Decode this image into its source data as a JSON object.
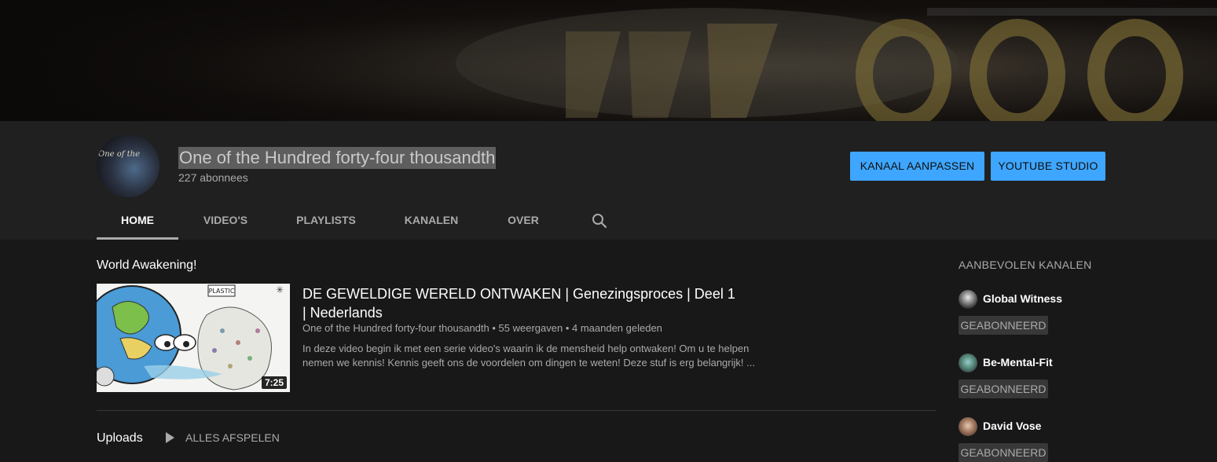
{
  "channel": {
    "name": "One of the Hundred forty-four thousandth",
    "subscribers": "227 abonnees",
    "avatar_text": "One of the"
  },
  "buttons": {
    "customize": "KANAAL AANPASSEN",
    "studio": "YOUTUBE STUDIO"
  },
  "tabs": [
    {
      "label": "HOME",
      "active": true
    },
    {
      "label": "VIDEO'S"
    },
    {
      "label": "PLAYLISTS"
    },
    {
      "label": "KANALEN"
    },
    {
      "label": "OVER"
    }
  ],
  "icons": {
    "tab_search": "search-icon",
    "play_all": "play-icon"
  },
  "featured": {
    "section_title": "World Awakening!",
    "video": {
      "title": "DE GEWELDIGE WERELD ONTWAKEN | Genezingsproces | Deel 1 | Nederlands",
      "meta": "One of the Hundred forty-four thousandth • 55 weergaven • 4 maanden geleden",
      "description": "In deze video begin ik met een serie video's waarin ik de mensheid help ontwaken! Om u te helpen nemen we kennis! Kennis geeft ons de voordelen om dingen te weten! Deze stuf is erg belangrijk! ...",
      "duration": "7:25",
      "thumb_sign": "PLASTIC"
    }
  },
  "uploads": {
    "title": "Uploads",
    "play_all": "ALLES AFSPELEN"
  },
  "sidebar": {
    "title": "AANBEVOLEN KANALEN",
    "channels": [
      {
        "name": "Global Witness",
        "button": "GEABONNEERD"
      },
      {
        "name": "Be-Mental-Fit",
        "button": "GEABONNEERD"
      },
      {
        "name": "David Vose",
        "button": "GEABONNEERD"
      }
    ]
  },
  "colors": {
    "accent_button": "#3ea6ff",
    "header_bg": "#202020",
    "page_bg": "#181818",
    "subscribed_bg": "#383838"
  }
}
